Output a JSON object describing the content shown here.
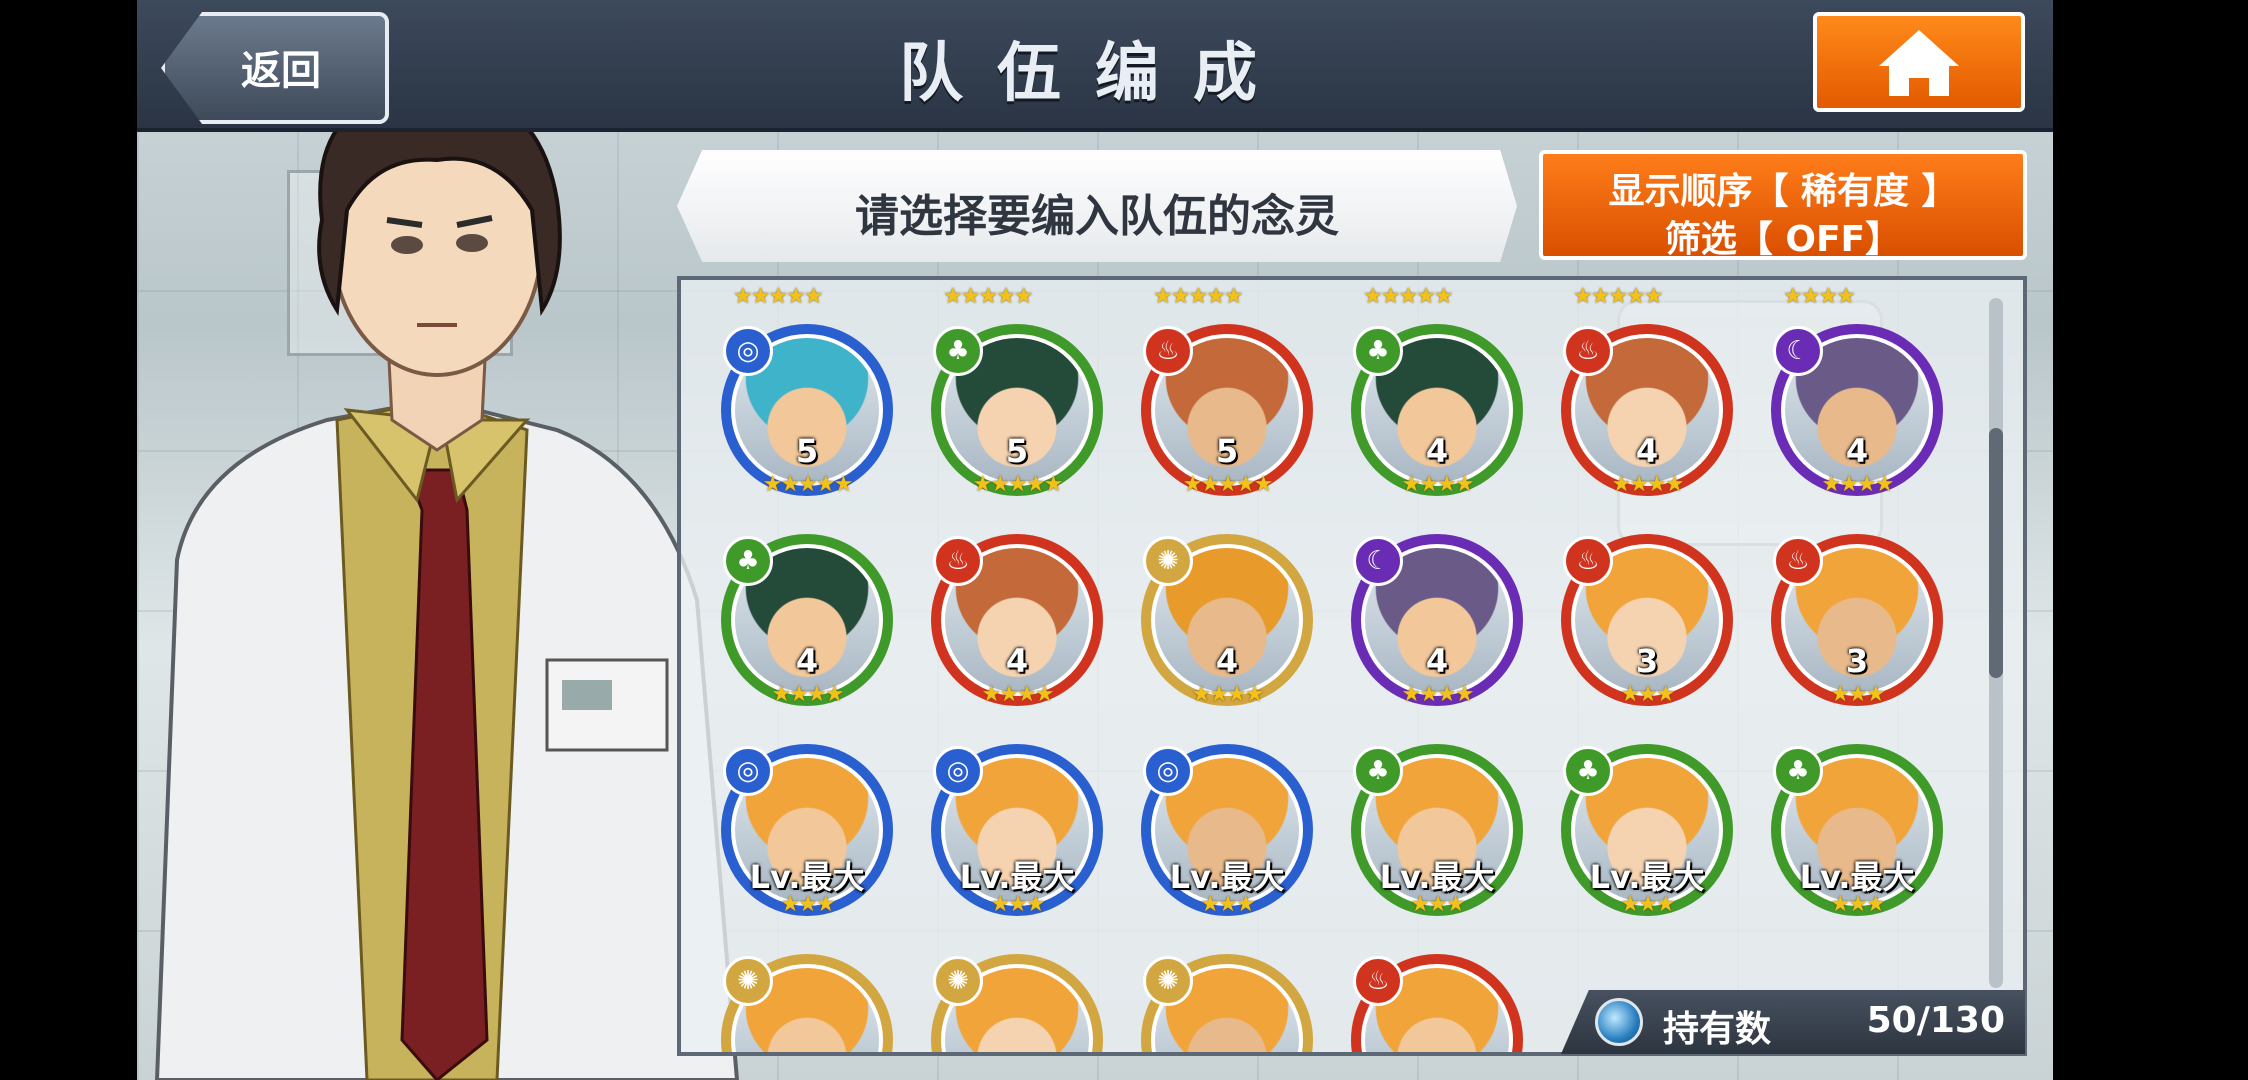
{
  "header": {
    "title": "队伍编成",
    "back_label": "返回"
  },
  "prompt": "请选择要编入队伍的念灵",
  "sort": {
    "line1": "显示顺序【 稀有度 】",
    "line2": "筛选【 OFF】"
  },
  "owned": {
    "label": "持有数",
    "count": "50/130"
  },
  "colors": {
    "water": "#2a5fd0",
    "wood": "#3f9a2a",
    "fire": "#d0341e",
    "dark": "#6a2bb5",
    "light": "#d2a640"
  },
  "top_stars": [
    "★★★★★",
    "★★★★★",
    "★★★★★",
    "★★★★★",
    "★★★★★",
    "★★★★"
  ],
  "cards": [
    {
      "element": "water",
      "level": "5",
      "stars": "★★★★★"
    },
    {
      "element": "wood",
      "level": "5",
      "stars": "★★★★★"
    },
    {
      "element": "fire",
      "level": "5",
      "stars": "★★★★★"
    },
    {
      "element": "wood",
      "level": "4",
      "stars": "★★★★"
    },
    {
      "element": "fire",
      "level": "4",
      "stars": "★★★★"
    },
    {
      "element": "dark",
      "level": "4",
      "stars": "★★★★"
    },
    {
      "element": "wood",
      "level": "4",
      "stars": "★★★★"
    },
    {
      "element": "fire",
      "level": "4",
      "stars": "★★★★"
    },
    {
      "element": "light",
      "level": "4",
      "stars": "★★★★"
    },
    {
      "element": "dark",
      "level": "4",
      "stars": "★★★★"
    },
    {
      "element": "fire",
      "level": "3",
      "stars": "★★★"
    },
    {
      "element": "fire",
      "level": "3",
      "stars": "★★★"
    },
    {
      "element": "water",
      "level": "Lv.最大",
      "stars": "★★★"
    },
    {
      "element": "water",
      "level": "Lv.最大",
      "stars": "★★★"
    },
    {
      "element": "water",
      "level": "Lv.最大",
      "stars": "★★★"
    },
    {
      "element": "wood",
      "level": "Lv.最大",
      "stars": "★★★"
    },
    {
      "element": "wood",
      "level": "Lv.最大",
      "stars": "★★★"
    },
    {
      "element": "wood",
      "level": "Lv.最大",
      "stars": "★★★"
    },
    {
      "element": "light",
      "level": "",
      "stars": ""
    },
    {
      "element": "light",
      "level": "",
      "stars": ""
    },
    {
      "element": "light",
      "level": "",
      "stars": ""
    },
    {
      "element": "fire",
      "level": "",
      "stars": ""
    }
  ]
}
